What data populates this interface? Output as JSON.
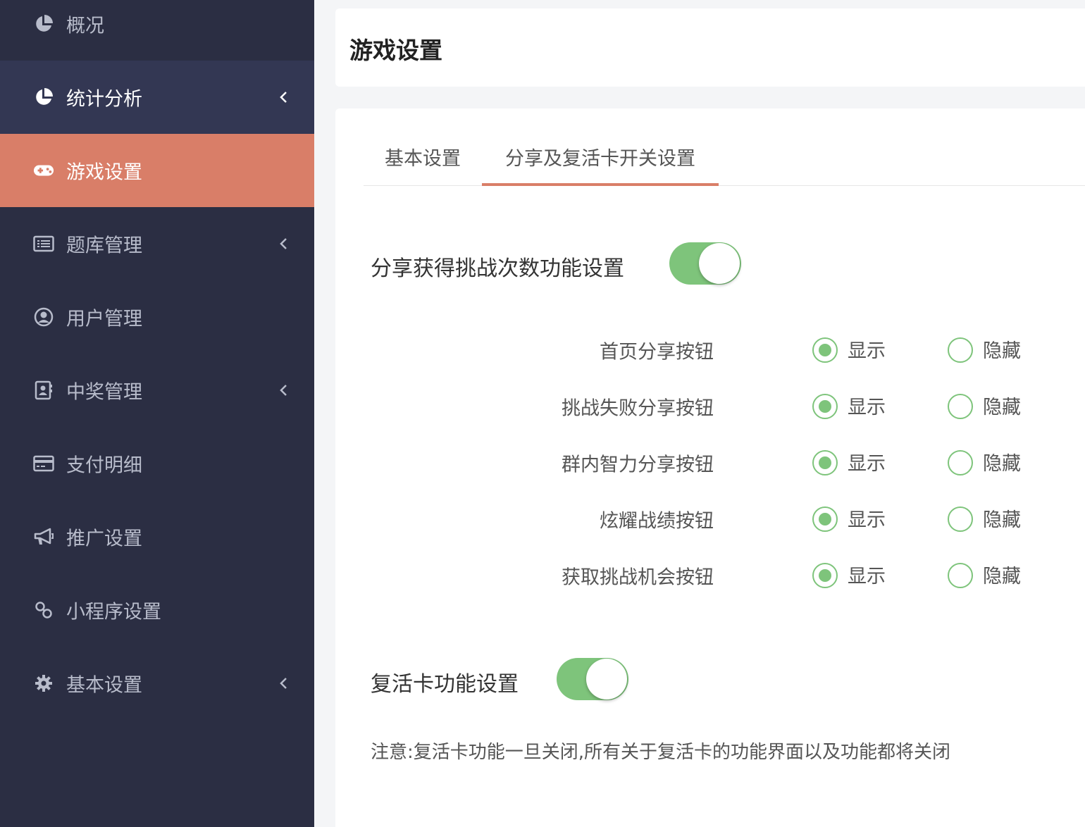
{
  "sidebar": {
    "items": [
      {
        "label": "概况",
        "icon": "pie-chart-icon",
        "chevron": false
      },
      {
        "label": "统计分析",
        "icon": "pie-chart-icon",
        "chevron": true
      },
      {
        "label": "游戏设置",
        "icon": "gamepad-icon",
        "chevron": false
      },
      {
        "label": "题库管理",
        "icon": "list-icon",
        "chevron": true
      },
      {
        "label": "用户管理",
        "icon": "user-circle-icon",
        "chevron": false
      },
      {
        "label": "中奖管理",
        "icon": "contact-card-icon",
        "chevron": true
      },
      {
        "label": "支付明细",
        "icon": "credit-card-icon",
        "chevron": false
      },
      {
        "label": "推广设置",
        "icon": "megaphone-icon",
        "chevron": false
      },
      {
        "label": "小程序设置",
        "icon": "link-icon",
        "chevron": false
      },
      {
        "label": "基本设置",
        "icon": "gear-icon",
        "chevron": true
      }
    ],
    "active_index": 2,
    "open_index": 1,
    "active_color": "#d97e68",
    "background": "#2b2e43"
  },
  "header": {
    "title": "游戏设置"
  },
  "tabs": [
    {
      "label": "基本设置",
      "active": false
    },
    {
      "label": "分享及复活卡开关设置",
      "active": true
    }
  ],
  "share_section": {
    "label": "分享获得挑战次数功能设置",
    "enabled": true,
    "options": [
      {
        "label": "首页分享按钮",
        "show_label": "显示",
        "hide_label": "隐藏",
        "selected": "show"
      },
      {
        "label": "挑战失败分享按钮",
        "show_label": "显示",
        "hide_label": "隐藏",
        "selected": "show"
      },
      {
        "label": "群内智力分享按钮",
        "show_label": "显示",
        "hide_label": "隐藏",
        "selected": "show"
      },
      {
        "label": "炫耀战绩按钮",
        "show_label": "显示",
        "hide_label": "隐藏",
        "selected": "show"
      },
      {
        "label": "获取挑战机会按钮",
        "show_label": "显示",
        "hide_label": "隐藏",
        "selected": "show"
      }
    ]
  },
  "revive_section": {
    "label": "复活卡功能设置",
    "enabled": true,
    "note": "注意:复活卡功能一旦关闭,所有关于复活卡的功能界面以及功能都将关闭"
  },
  "toggle_color": "#7ec47b"
}
